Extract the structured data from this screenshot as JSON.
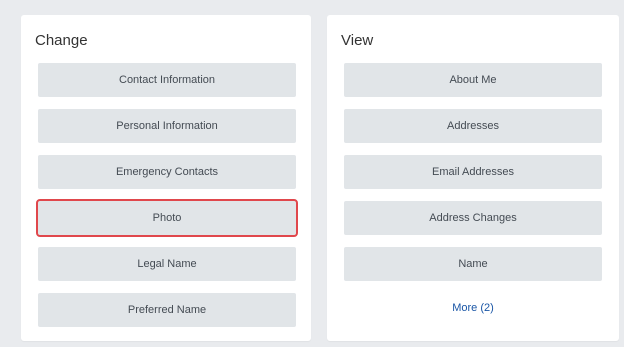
{
  "change": {
    "title": "Change",
    "buttons": [
      {
        "label": "Contact Information"
      },
      {
        "label": "Personal Information"
      },
      {
        "label": "Emergency Contacts"
      },
      {
        "label": "Photo"
      },
      {
        "label": "Legal Name"
      },
      {
        "label": "Preferred Name"
      }
    ]
  },
  "view": {
    "title": "View",
    "buttons": [
      {
        "label": "About Me"
      },
      {
        "label": "Addresses"
      },
      {
        "label": "Email Addresses"
      },
      {
        "label": "Address Changes"
      },
      {
        "label": "Name"
      }
    ],
    "more_label": "More (2)"
  },
  "colors": {
    "highlight": "#e0474c",
    "link": "#1a56a6",
    "button_bg": "#e1e5e8"
  }
}
